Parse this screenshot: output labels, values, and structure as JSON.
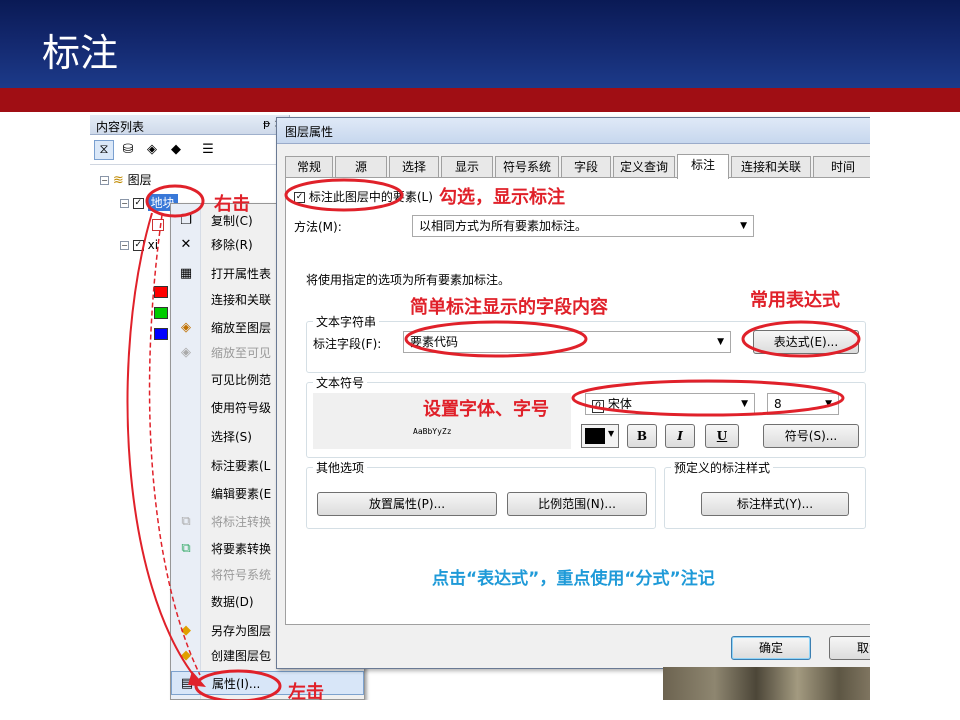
{
  "slide": {
    "title": "标注"
  },
  "toc": {
    "title": "内容列表",
    "pin": "ᵽ ×",
    "root": "图层",
    "layer_selected": "地块",
    "layer_second": "xi"
  },
  "context_menu": {
    "items": [
      {
        "label": "复制(C)",
        "icon": "copy-icon",
        "glyph": "❐",
        "disabled": false
      },
      {
        "label": "移除(R)",
        "icon": "remove-icon",
        "glyph": "✕",
        "disabled": false
      },
      {
        "label": "打开属性表",
        "icon": "table-icon",
        "glyph": "▦",
        "disabled": false
      },
      {
        "label": "连接和关联",
        "icon": "",
        "glyph": "",
        "disabled": false
      },
      {
        "label": "缩放至图层",
        "icon": "zoom-layer-icon",
        "glyph": "◈",
        "disabled": false
      },
      {
        "label": "缩放至可见",
        "icon": "zoom-visible-icon",
        "glyph": "◈",
        "disabled": true
      },
      {
        "label": "可见比例范",
        "icon": "",
        "glyph": "",
        "disabled": false
      },
      {
        "label": "使用符号级",
        "icon": "",
        "glyph": "",
        "disabled": false
      },
      {
        "label": "选择(S)",
        "icon": "",
        "glyph": "",
        "disabled": false
      },
      {
        "label": "标注要素(L",
        "icon": "",
        "glyph": "",
        "disabled": false
      },
      {
        "label": "编辑要素(E",
        "icon": "",
        "glyph": "",
        "disabled": false
      },
      {
        "label": "将标注转换",
        "icon": "convert-labels-icon",
        "glyph": "⧉",
        "disabled": true
      },
      {
        "label": "将要素转换",
        "icon": "convert-features-icon",
        "glyph": "⧉",
        "disabled": false
      },
      {
        "label": "将符号系统",
        "icon": "",
        "glyph": "",
        "disabled": true
      },
      {
        "label": "数据(D)",
        "icon": "",
        "glyph": "",
        "disabled": false
      },
      {
        "label": "另存为图层",
        "icon": "layer-file-icon",
        "glyph": "◆",
        "disabled": false
      },
      {
        "label": "创建图层包",
        "icon": "layer-package-icon",
        "glyph": "◆",
        "disabled": false
      },
      {
        "label": "属性(I)...",
        "icon": "properties-icon",
        "glyph": "▤",
        "disabled": false
      }
    ]
  },
  "dialog": {
    "title": "图层属性",
    "tabs": [
      "常规",
      "源",
      "选择",
      "显示",
      "符号系统",
      "字段",
      "定义查询",
      "标注",
      "连接和关联",
      "时间"
    ],
    "active_tab": "标注",
    "label_checkbox": "标注此图层中的要素(L)",
    "method_label": "方法(M):",
    "method_value": "以相同方式为所有要素加标注。",
    "info_text": "将使用指定的选项为所有要素加标注。",
    "text_string_group": "文本字符串",
    "label_field_label": "标注字段(F):",
    "label_field_value": "要素代码",
    "expression_button": "表达式(E)...",
    "text_symbol_group": "文本符号",
    "sample_text": "AaBbYyZz",
    "font_value": "宋体",
    "size_value": "8",
    "bold": "B",
    "italic": "I",
    "underline": "U",
    "symbol_button": "符号(S)...",
    "other_options_group": "其他选项",
    "placement_button": "放置属性(P)...",
    "scale_range_button": "比例范围(N)...",
    "predefined_group": "预定义的标注样式",
    "label_styles_button": "标注样式(Y)...",
    "ok_button": "确定",
    "cancel_button": "取消"
  },
  "annotations": {
    "right_click": "右击",
    "left_click": "左击",
    "check_show": "勾选，显示标注",
    "field_note": "简单标注显示的字段内容",
    "common_expr": "常用表达式",
    "font_note": "设置字体、字号",
    "bottom_note": "点击“表达式”，重点使用“分式”注记"
  },
  "colors": {
    "header": "#13286e",
    "band": "#a00e14",
    "annotation_red": "#e0212a",
    "annotation_blue": "#1f9ad8",
    "swatches": [
      "#ff0000",
      "#00cc00",
      "#0000ff"
    ]
  }
}
